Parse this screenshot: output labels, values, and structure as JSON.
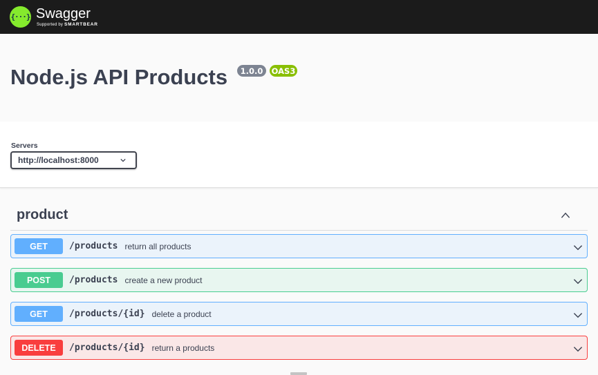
{
  "topbar": {
    "logo_mark": "{···}",
    "logo_title": "Swagger",
    "logo_sub_prefix": "Supported by",
    "logo_sub_brand": "SMARTBEAR",
    "bg_color": "#1b1b1b",
    "logo_color": "#85ea2d"
  },
  "info": {
    "title": "Node.js API Products",
    "version": "1.0.0",
    "oas": "OAS3"
  },
  "servers": {
    "label": "Servers",
    "selected": "http://localhost:8000"
  },
  "tag": {
    "name": "product",
    "icon": "chevron-up-icon"
  },
  "operations": [
    {
      "method": "GET",
      "path": "/products",
      "summary": "return all products",
      "color": "#61affe"
    },
    {
      "method": "POST",
      "path": "/products",
      "summary": "create a new product",
      "color": "#49cc90"
    },
    {
      "method": "GET",
      "path": "/products/{id}",
      "summary": "delete a product",
      "color": "#61affe"
    },
    {
      "method": "DELETE",
      "path": "/products/{id}",
      "summary": "return a products",
      "color": "#f93e3e"
    }
  ]
}
